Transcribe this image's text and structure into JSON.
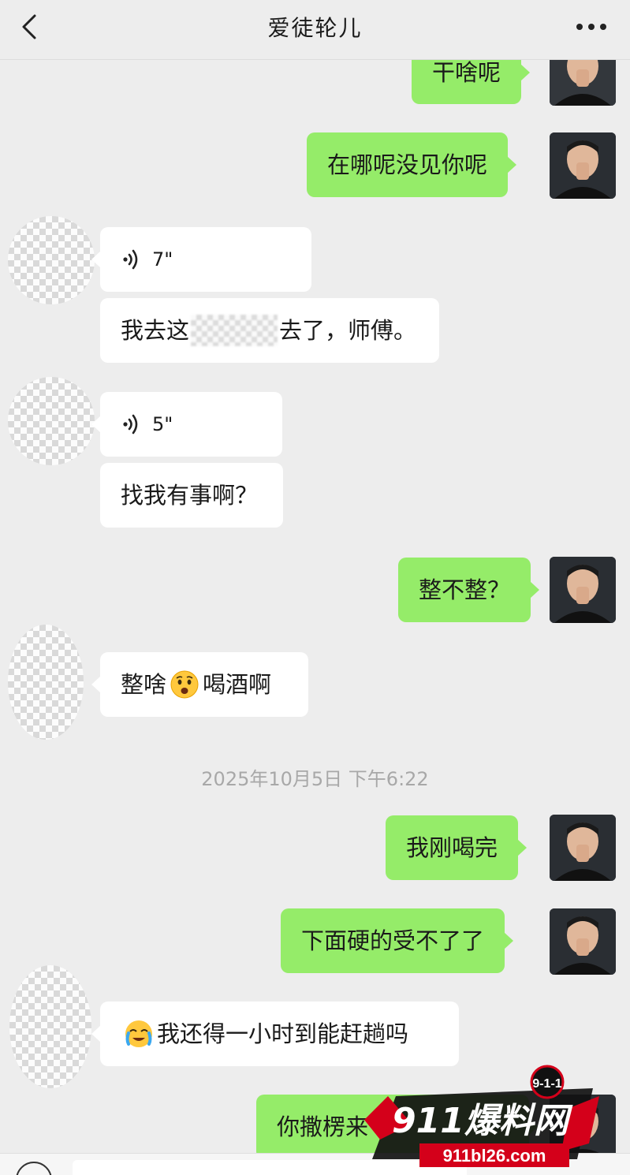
{
  "header": {
    "title": "爱徒轮儿",
    "back_icon": "chevron-left-icon",
    "more_icon": "more-dots-icon"
  },
  "messages": [
    {
      "from": "me",
      "type": "text",
      "text": "干啥呢"
    },
    {
      "from": "me",
      "type": "text",
      "text": "在哪呢没见你呢"
    },
    {
      "from": "other",
      "type": "voice",
      "duration": "7\""
    },
    {
      "from": "other",
      "type": "text",
      "text_before": "我去这",
      "text_after": "去了，师傅。"
    },
    {
      "from": "other",
      "type": "voice",
      "duration": "5\""
    },
    {
      "from": "other",
      "type": "text",
      "text": "找我有事啊？"
    },
    {
      "from": "me",
      "type": "text",
      "text": "整不整？"
    },
    {
      "from": "other",
      "type": "text",
      "text_before": "整啥",
      "emoji": "worried-face-emoji",
      "text_after": "喝酒啊"
    },
    {
      "type": "timestamp",
      "text": "2025年10月5日 下午6:22"
    },
    {
      "from": "me",
      "type": "text",
      "text": "我刚喝完"
    },
    {
      "from": "me",
      "type": "text",
      "text": "下面硬的受不了了"
    },
    {
      "from": "other",
      "type": "text",
      "emoji": "crying-face-emoji",
      "text": "我还得一小时到能赶趟吗"
    },
    {
      "from": "me",
      "type": "text",
      "text": "你撒楞来"
    }
  ],
  "watermark": {
    "badge": "9-1-1",
    "brand": "911爆料网",
    "url": "911bl26.com"
  },
  "colors": {
    "background": "#ededed",
    "my_bubble": "#95ec69",
    "other_bubble": "#ffffff",
    "timestamp_text": "#a8a8a8",
    "watermark_red": "#d4001a"
  }
}
